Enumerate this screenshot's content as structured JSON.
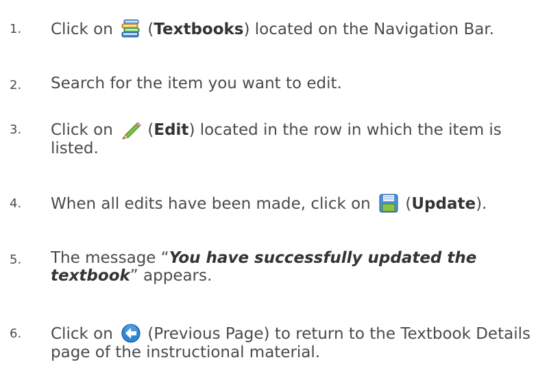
{
  "steps": [
    {
      "number": "1.",
      "before": "Click on",
      "icon": "textbooks-icon",
      "paren_open": " (",
      "bold": "Textbooks",
      "after": ") located on the Navigation Bar."
    },
    {
      "number": "2.",
      "text": "Search for the item you want to edit."
    },
    {
      "number": "3.",
      "before": "Click on",
      "icon": "pencil-edit-icon",
      "paren_open": " (",
      "bold": "Edit",
      "after": ") located in the row in which the item is listed."
    },
    {
      "number": "4.",
      "before": "When all edits have been made, click on",
      "icon": "save-floppy-icon",
      "paren_open": " (",
      "bold": "Update",
      "after": ")."
    },
    {
      "number": "5.",
      "before": "The message “",
      "bold_italic": "You have successfully updated the textbook",
      "after": "” appears."
    },
    {
      "number": "6.",
      "before": "Click on",
      "icon": "previous-page-arrow-icon",
      "after": " (Previous Page) to return to the Textbook Details page of the instructional material."
    }
  ]
}
